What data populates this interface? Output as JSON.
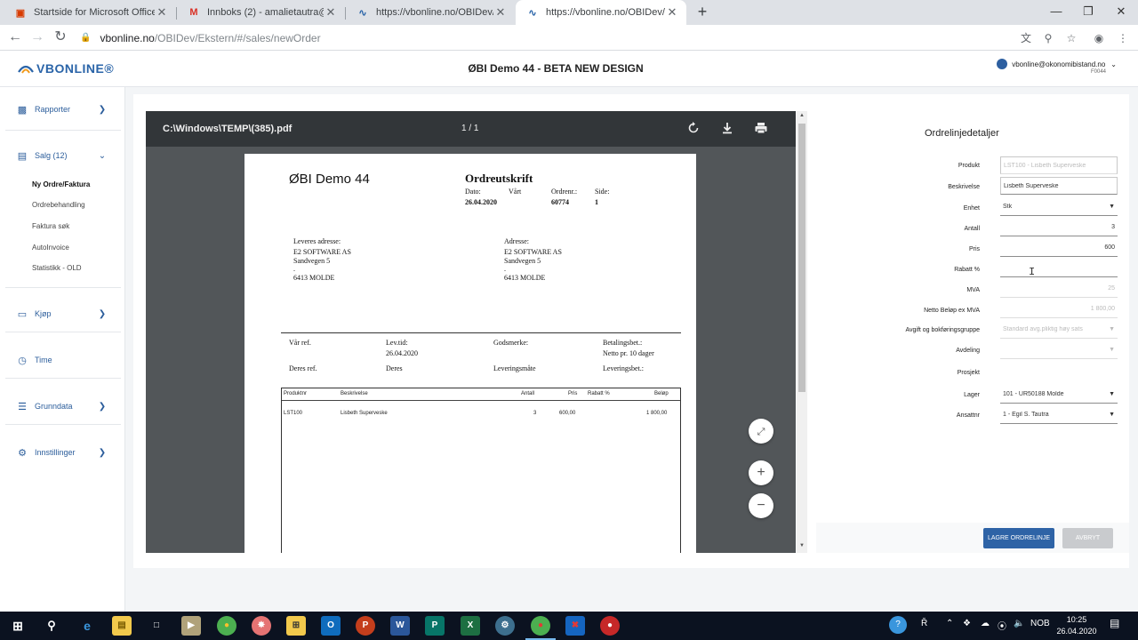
{
  "browser": {
    "tabs": [
      {
        "title": "Startside for Microsoft Office",
        "icon": "office-icon",
        "color": "#d83b01"
      },
      {
        "title": "Innboks (2) - amalietautra@gma",
        "icon": "gmail-icon",
        "color": "#d93025"
      },
      {
        "title": "https://vbonline.no/OBIDev/#/ac",
        "icon": "vbonline-icon",
        "color": "#2a64a8"
      },
      {
        "title": "https://vbonline.no/OBIDev/Ekst",
        "icon": "vbonline-icon",
        "color": "#2a64a8"
      }
    ],
    "new_tab": "+",
    "url_host": "vbonline.no",
    "url_path": "/OBIDev/Ekstern/#/sales/newOrder"
  },
  "app": {
    "logo_text": "VBONLINE®",
    "title": "ØBI Demo 44 - BETA NEW DESIGN",
    "user_email": "vbonline@okonomibistand.no",
    "user_code": "F0044",
    "brand_color": "#2a64a8"
  },
  "sidebar": {
    "rapporter": "Rapporter",
    "salg": "Salg (12)",
    "salg_items": [
      "Ny Ordre/Faktura",
      "Ordrebehandling",
      "Faktura søk",
      "AutoInvoice",
      "Statistikk - OLD"
    ],
    "kjop": "Kjøp",
    "time": "Time",
    "grunndata": "Grunndata",
    "innstillinger": "Innstillinger"
  },
  "pdf": {
    "filename": "C:\\Windows\\TEMP\\(385).pdf",
    "pages": "1 / 1",
    "doc": {
      "company": "ØBI Demo 44",
      "title": "Ordreutskrift",
      "dato_label": "Dato:",
      "dato": "26.04.2020",
      "vart_label": "Vårt",
      "ordrenr_label": "Ordrenr.:",
      "ordrenr": "60774",
      "side_label": "Side:",
      "side": "1",
      "leveres_label": "Leveres adresse:",
      "leveres_lines": [
        "E2 SOFTWARE AS",
        "Sandvegen 5",
        ".",
        "6413  MOLDE"
      ],
      "adresse_label": "Adresse:",
      "adresse_lines": [
        "E2 SOFTWARE AS",
        "Sandvegen 5",
        ".",
        "6413  MOLDE"
      ],
      "var_ref": "Vår ref.",
      "lev_tid": "Lev.tid:",
      "lev_tid_val": "26.04.2020",
      "godsmerke": "Godsmerke:",
      "betalingsbet": "Betalingsbet.:",
      "betalingsbet_val": "Netto pr. 10 dager",
      "deres_ref": "Deres ref.",
      "deres": "Deres",
      "leveringsmate": "Leveringsmåte",
      "leveringsbet": "Leveringsbet.:",
      "table_headers": [
        "Produktnr",
        "Beskrivelse",
        "Antall",
        "Pris",
        "Rabatt %",
        "Beløp"
      ],
      "table_rows": [
        [
          "LST100",
          "Lisbeth Superveske",
          "3",
          "600,00",
          "",
          "1 800,00"
        ]
      ]
    }
  },
  "form": {
    "title": "Ordrelinjedetaljer",
    "fields": {
      "produkt": {
        "label": "Produkt",
        "value": "LST100 - Lisbeth Superveske"
      },
      "beskrivelse": {
        "label": "Beskrivelse",
        "value": "Lisbeth Superveske"
      },
      "enhet": {
        "label": "Enhet",
        "value": "Stk"
      },
      "antall": {
        "label": "Antall",
        "value": "3"
      },
      "pris": {
        "label": "Pris",
        "value": "600"
      },
      "rabatt": {
        "label": "Rabatt %",
        "value": ""
      },
      "mva": {
        "label": "MVA",
        "value": "25"
      },
      "netto": {
        "label": "Netto Beløp ex MVA",
        "value": "1 800,00"
      },
      "avgift": {
        "label": "Avgift og bokføringsgruppe",
        "value": "Standard avg.pliktig høy sats"
      },
      "avdeling": {
        "label": "Avdeling",
        "value": ""
      },
      "prosjekt": {
        "label": "Prosjekt",
        "value": ""
      },
      "lager": {
        "label": "Lager",
        "value": "101 - UR50188 Molde"
      },
      "ansattnr": {
        "label": "Ansattnr",
        "value": "1 - Egil S. Tautra"
      }
    },
    "save_label": "LAGRE ORDRELINJE",
    "cancel_label": "AVBRYT"
  },
  "taskbar": {
    "lang": "NOB",
    "time": "10:25",
    "date": "26.04.2020"
  }
}
